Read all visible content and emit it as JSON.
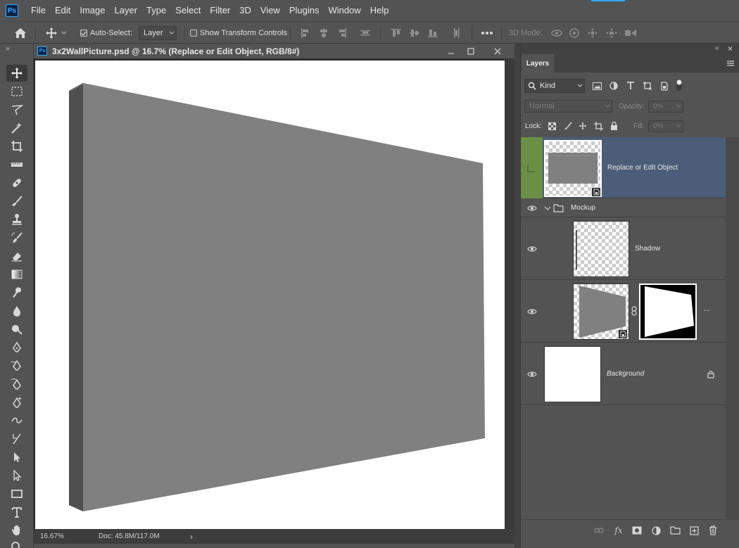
{
  "app": {
    "logo": "Ps"
  },
  "menu": [
    "File",
    "Edit",
    "Image",
    "Layer",
    "Type",
    "Select",
    "Filter",
    "3D",
    "View",
    "Plugins",
    "Window",
    "Help"
  ],
  "options": {
    "auto_select_label": "Auto-Select:",
    "auto_select_checked": true,
    "auto_select_target": "Layer",
    "show_transform_label": "Show Transform Controls",
    "show_transform_checked": false,
    "mode_3d_label": "3D Mode:"
  },
  "document": {
    "icon": "Ps",
    "title": "3x2WallPicture.psd @ 16.7% (Replace or Edit Object, RGB/8#)",
    "zoom": "16.67%",
    "doc_info": "Doc: 45.8M/117.0M",
    "status_arrow": "›"
  },
  "layers_panel": {
    "tab_label": "Layers",
    "filter_kind": "Kind",
    "blend_mode": "Normal",
    "opacity_label": "Opacity:",
    "opacity_value": "0%",
    "lock_label": "Lock:",
    "fill_label": "Fill:",
    "fill_value": "0%",
    "layers": [
      {
        "name": "Replace or Edit Object",
        "selected": true,
        "type": "smart-object"
      },
      {
        "name": "Mockup",
        "type": "group"
      },
      {
        "name": "Shadow",
        "type": "pixel"
      },
      {
        "name": "...",
        "type": "smart-object-masked"
      },
      {
        "name": "Background",
        "type": "background",
        "locked": true
      }
    ]
  },
  "colors": {
    "panel_bg": "#535353",
    "selection": "#4b5d78",
    "accent": "#31a8ff",
    "layer_mark": "#6b8f45",
    "wall_front": "#808080",
    "wall_side": "#4f4f4f"
  }
}
